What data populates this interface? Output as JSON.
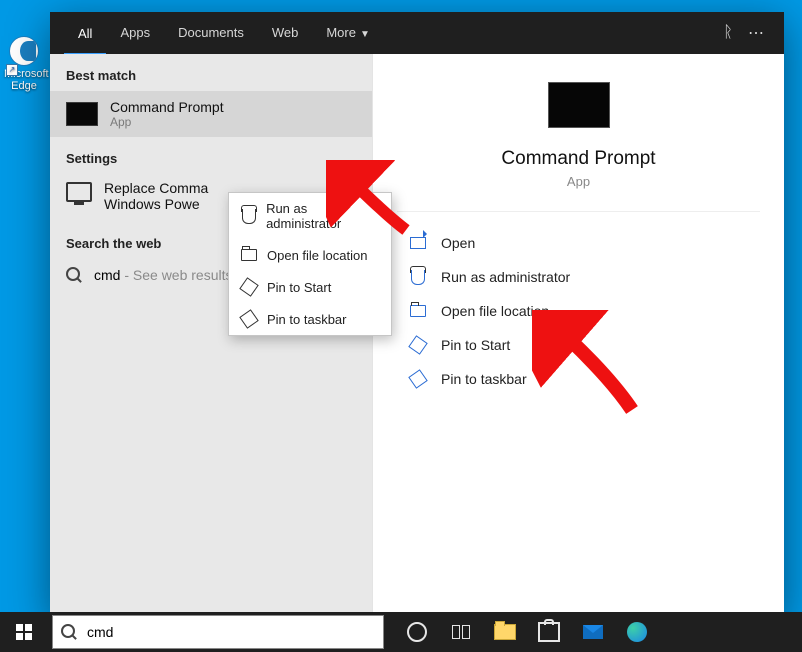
{
  "desktop": {
    "icon_label": "Microsoft Edge"
  },
  "topbar": {
    "tabs": {
      "all": "All",
      "apps": "Apps",
      "documents": "Documents",
      "web": "Web",
      "more": "More"
    }
  },
  "left": {
    "best_match": "Best match",
    "result": {
      "title": "Command Prompt",
      "subtitle": "App"
    },
    "settings_label": "Settings",
    "setting_item": "Replace Command Prompt with Windows PowerShell",
    "setting_item_visible": "Replace Comma          \nWindows Powe",
    "search_web_label": "Search the web",
    "web_query": "cmd",
    "web_suffix": " - See web results"
  },
  "ctx": {
    "run_admin": "Run as administrator",
    "open_loc": "Open file location",
    "pin_start": "Pin to Start",
    "pin_taskbar": "Pin to taskbar"
  },
  "preview": {
    "title": "Command Prompt",
    "subtitle": "App",
    "open": "Open",
    "run_admin": "Run as administrator",
    "open_loc": "Open file location",
    "pin_start": "Pin to Start",
    "pin_taskbar": "Pin to taskbar"
  },
  "taskbar": {
    "search_value": "cmd"
  }
}
